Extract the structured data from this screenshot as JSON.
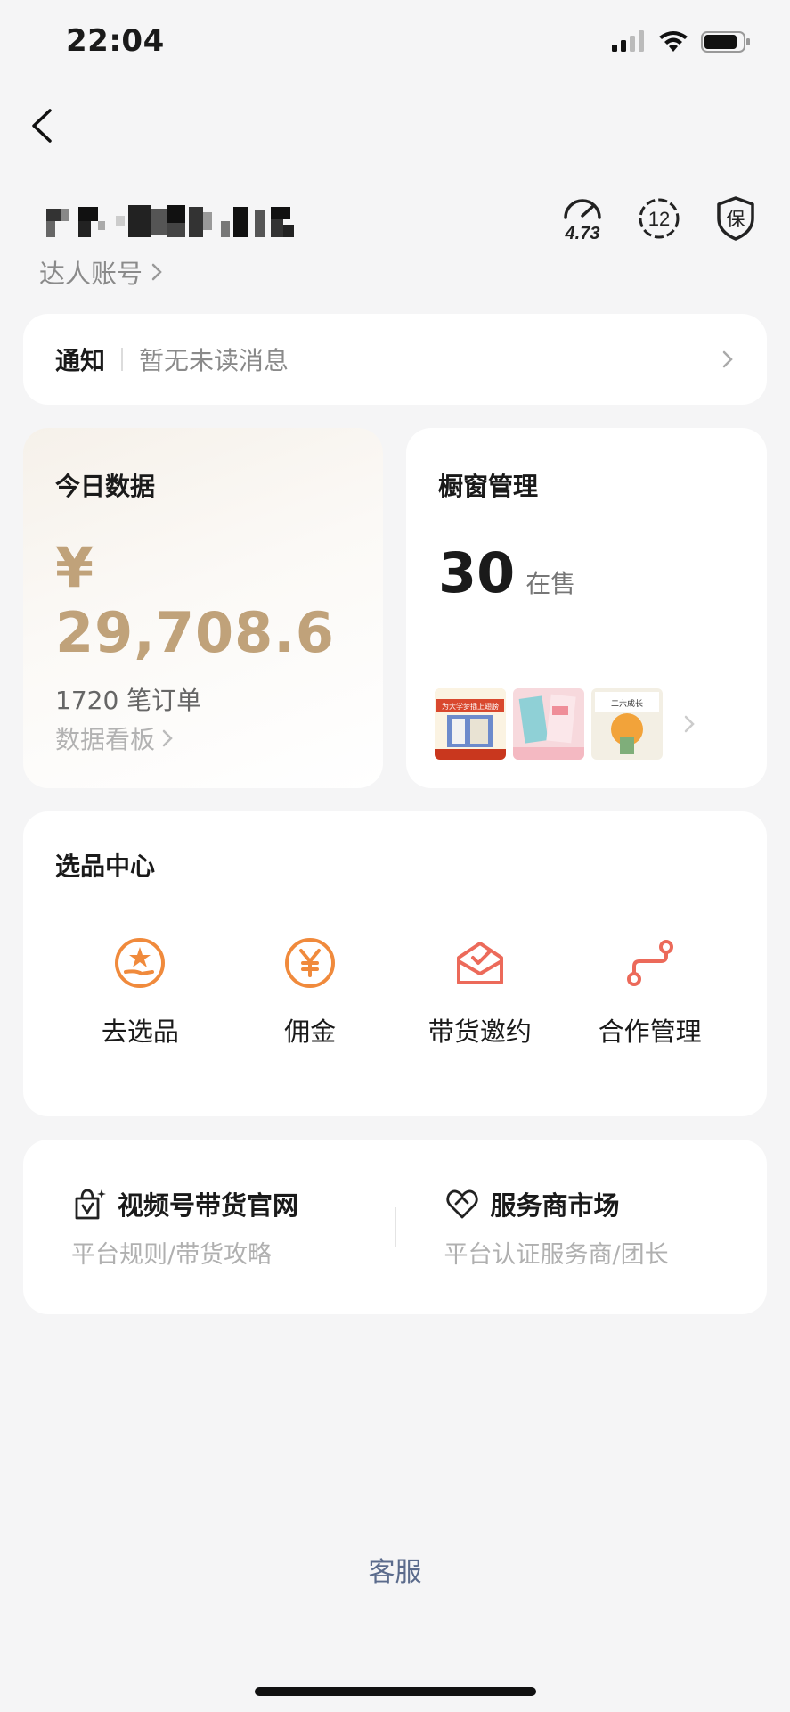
{
  "status_bar": {
    "time": "22:04"
  },
  "account": {
    "type_label": "达人账号"
  },
  "header_icons": {
    "rating": "4.73",
    "badge_number": "12",
    "guarantee": "保"
  },
  "notice": {
    "title": "通知",
    "text": "暂无未读消息"
  },
  "today": {
    "title": "今日数据",
    "amount": "¥ 29,708.6",
    "orders": "1720 笔订单",
    "link": "数据看板"
  },
  "window": {
    "title": "橱窗管理",
    "count": "30",
    "count_label": "在售",
    "thumbs": [
      {
        "caption": "为大学梦插上翅膀"
      },
      {
        "caption": ""
      },
      {
        "caption": "二六成长"
      }
    ]
  },
  "pick_center": {
    "title": "选品中心",
    "items": [
      {
        "label": "去选品",
        "icon": "hand-star-icon"
      },
      {
        "label": "佣金",
        "icon": "yen-coin-icon"
      },
      {
        "label": "带货邀约",
        "icon": "envelope-check-icon"
      },
      {
        "label": "合作管理",
        "icon": "route-icon"
      }
    ]
  },
  "links": [
    {
      "title": "视频号带货官网",
      "sub": "平台规则/带货攻略",
      "icon": "shopping-bag-sparkle-icon"
    },
    {
      "title": "服务商市场",
      "sub": "平台认证服务商/团长",
      "icon": "heart-handshake-icon"
    }
  ],
  "footer": {
    "service": "客服"
  },
  "colors": {
    "gold": "#c0a27a",
    "orange": "#f08a3c",
    "red": "#ec6a5a",
    "link_blue": "#5b6b8c"
  }
}
